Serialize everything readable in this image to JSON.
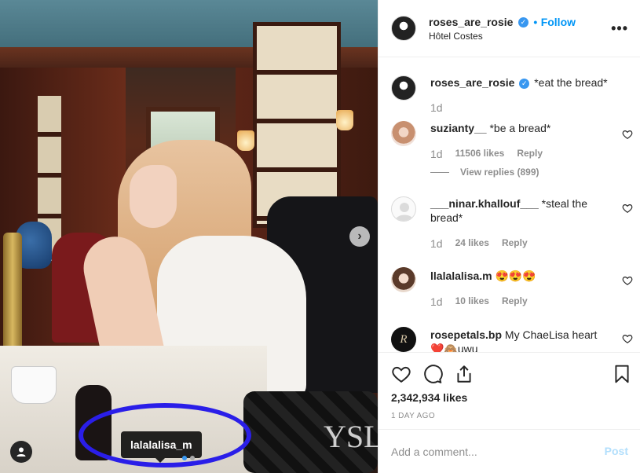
{
  "photo": {
    "tag_label": "lalalalisa_m",
    "next_icon": "chevron-right-icon",
    "user_tag_icon": "person-icon",
    "highlight_color": "#2a1ee8",
    "bag_logo": "YSL"
  },
  "header": {
    "username": "roses_are_rosie",
    "separator": "•",
    "follow_label": "Follow",
    "location": "Hôtel Costes",
    "more_label": "•••"
  },
  "caption": {
    "username": "roses_are_rosie",
    "text": "*eat the bread*",
    "time": "1d"
  },
  "comments": [
    {
      "username": "suzianty__",
      "text": "*be a bread*",
      "time": "1d",
      "likes": "11506 likes",
      "reply_label": "Reply",
      "view_replies": "View replies (899)"
    },
    {
      "username": "___ninar.khallouf___",
      "text_line1": "*steal the",
      "text_line2": "bread*",
      "time": "1d",
      "likes": "24 likes",
      "reply_label": "Reply"
    },
    {
      "username": "llalalalisa.m",
      "text": "😍😍😍",
      "time": "1d",
      "likes": "10 likes",
      "reply_label": "Reply"
    },
    {
      "username": "rosepetals.bp",
      "text_line1": "My ChaeLisa heart",
      "text_line2": "❤️🙈uwu",
      "avatar_letter": "R"
    }
  ],
  "actions": {
    "likes": "2,342,934 likes",
    "date": "1 DAY AGO"
  },
  "add_comment": {
    "placeholder": "Add a comment...",
    "post_label": "Post"
  },
  "colors": {
    "accent": "#0095f6",
    "muted": "#8e8e8e",
    "post_disabled": "#b2dffc"
  }
}
